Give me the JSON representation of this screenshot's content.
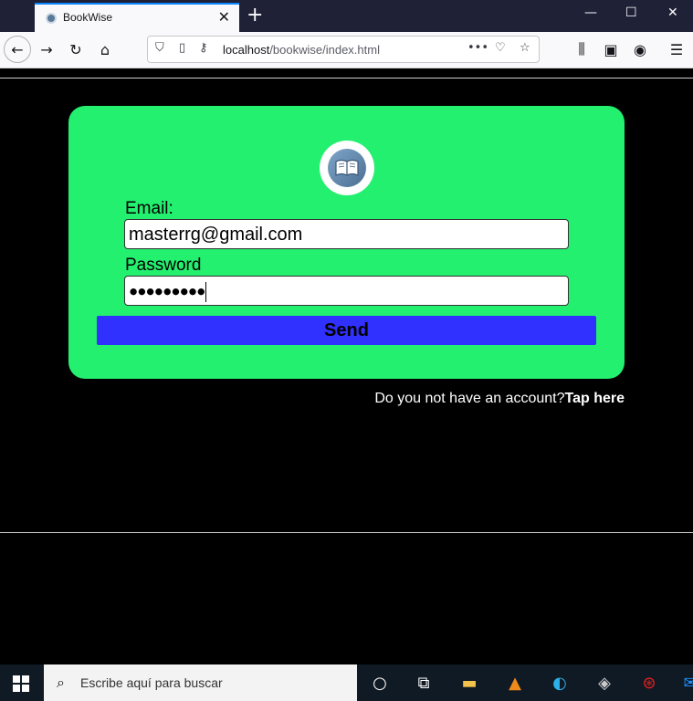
{
  "browser": {
    "tab_title": "BookWise",
    "url_host": "localhost",
    "url_path": "/bookwise/index.html"
  },
  "login": {
    "email_label": "Email:",
    "email_value": "masterrg@gmail.com",
    "password_label": "Password",
    "password_mask": "●●●●●●●●●",
    "send_label": "Send"
  },
  "signup": {
    "prompt": "Do you not have an account?",
    "link": "Tap here"
  },
  "taskbar": {
    "search_placeholder": "Escribe aquí para buscar"
  },
  "colors": {
    "card": "#23f06f",
    "button": "#3030ff",
    "page_bg": "#000000"
  }
}
